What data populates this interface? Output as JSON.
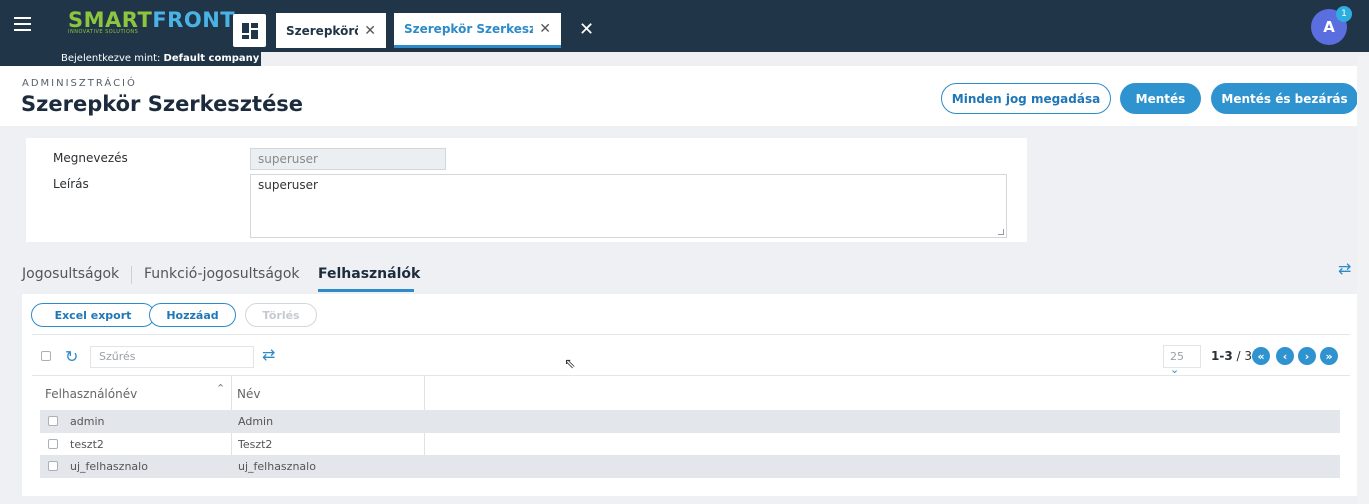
{
  "topbar": {
    "logo_smart": "SMART",
    "logo_front": "FRONT",
    "logo_tagline": "INNOVATIVE SOLUTIONS",
    "tabs": [
      {
        "label": "Szerepkörök"
      },
      {
        "label": "Szerepkör Szerkeszté..."
      }
    ],
    "avatar_letter": "A",
    "notification_count": "1",
    "login_prefix": "Bejelentkezve mint: ",
    "login_company": "Default company"
  },
  "header": {
    "breadcrumb": "ADMINISZTRÁCIÓ",
    "title": "Szerepkör Szerkesztése",
    "btn_grant_all": "Minden jog megadása",
    "btn_save": "Mentés",
    "btn_save_close": "Mentés és bezárás"
  },
  "form": {
    "name_label": "Megnevezés",
    "name_value": "superuser",
    "desc_label": "Leírás",
    "desc_value": "superuser"
  },
  "subtabs": [
    {
      "label": "Jogosultságok"
    },
    {
      "label": "Funkció-jogosultságok"
    },
    {
      "label": "Felhasználók",
      "active": true
    }
  ],
  "toolbar": {
    "excel_export": "Excel export",
    "add": "Hozzáad",
    "delete": "Törlés",
    "filter_placeholder": "Szűrés",
    "page_size": "25",
    "page_range": "1-3",
    "page_total": " / 3"
  },
  "table": {
    "columns": [
      "Felhasználónév",
      "Név"
    ],
    "rows": [
      {
        "username": "admin",
        "name": "Admin"
      },
      {
        "username": "teszt2",
        "name": "Teszt2"
      },
      {
        "username": "uj_felhasznalo",
        "name": "uj_felhasznalo"
      }
    ]
  },
  "colors": {
    "topbar": "#203548",
    "accent": "#2f93d0",
    "logo_green": "#8cc63e",
    "logo_blue": "#4ab3e6",
    "avatar": "#5b6ee0"
  },
  "icons": [
    "hamburger-icon",
    "dashboard-icon",
    "close-icon",
    "refresh-icon",
    "swap-icon",
    "chevron-down-icon",
    "first-page-icon",
    "prev-page-icon",
    "next-page-icon",
    "last-page-icon",
    "sort-up-icon",
    "mouse-cursor-icon"
  ]
}
